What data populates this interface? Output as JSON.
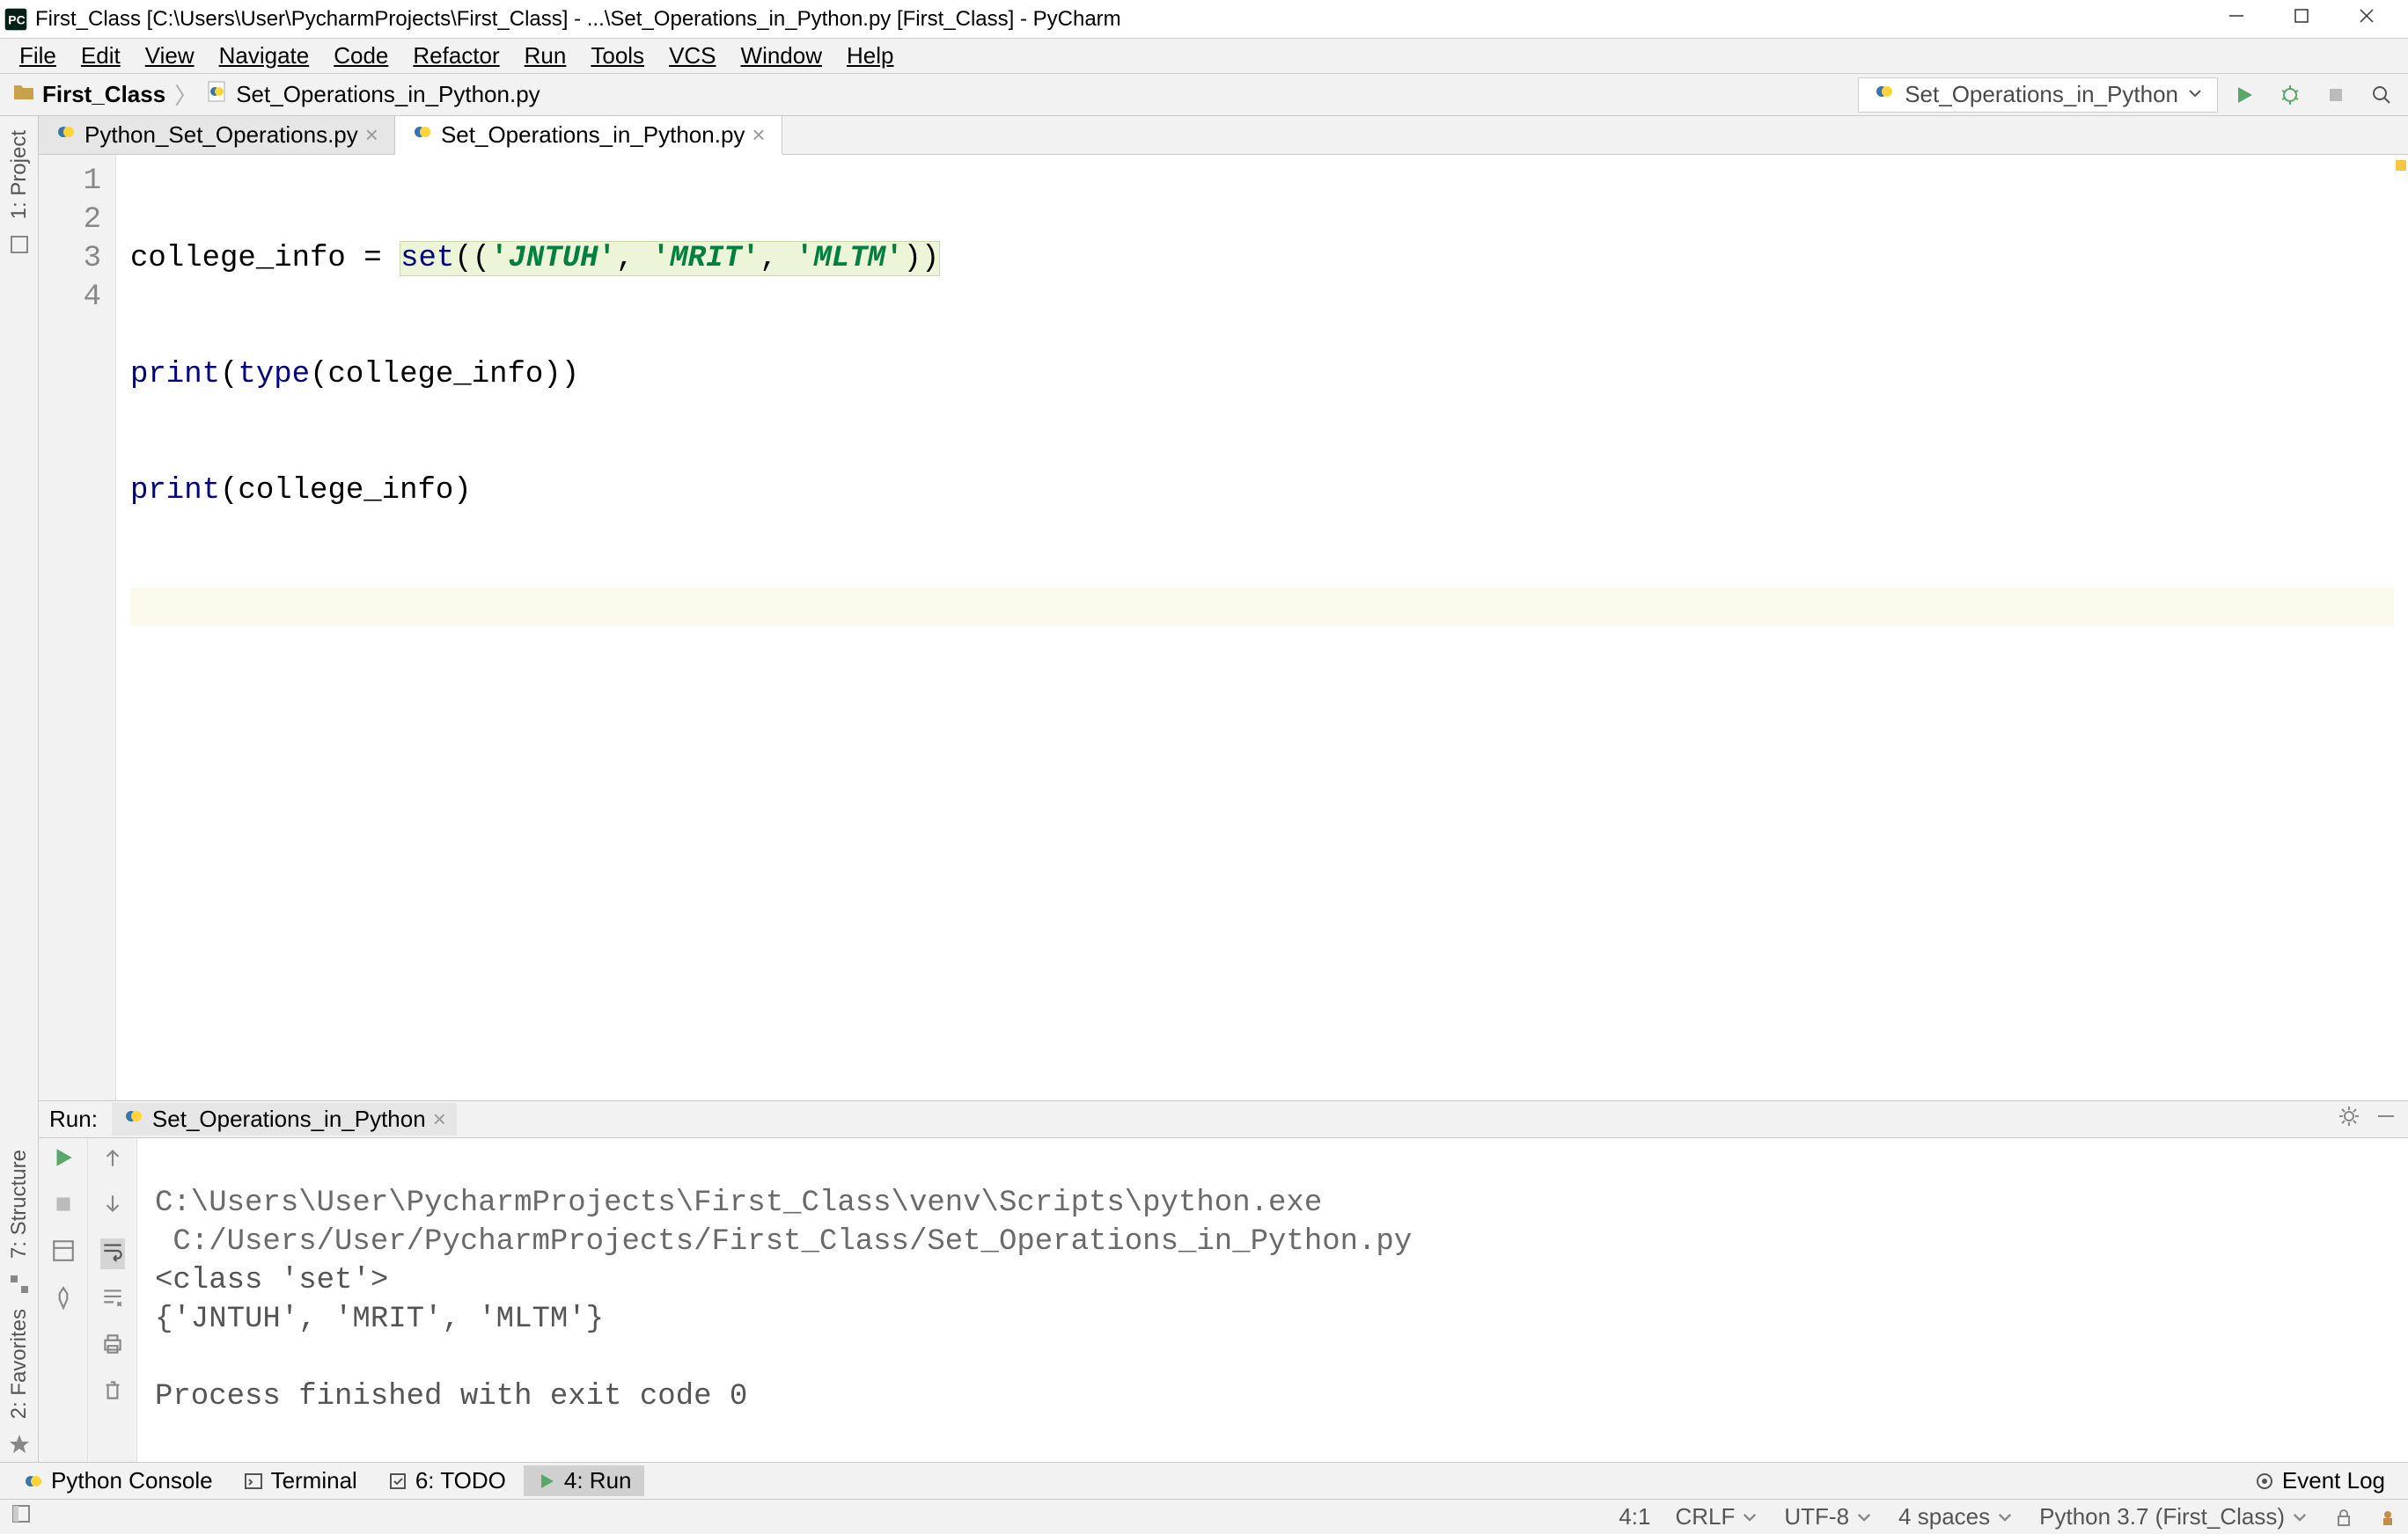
{
  "window": {
    "title": "First_Class [C:\\Users\\User\\PycharmProjects\\First_Class] - ...\\Set_Operations_in_Python.py [First_Class] - PyCharm"
  },
  "menu": {
    "file": "File",
    "edit": "Edit",
    "view": "View",
    "navigate": "Navigate",
    "code": "Code",
    "refactor": "Refactor",
    "run": "Run",
    "tools": "Tools",
    "vcs": "VCS",
    "window": "Window",
    "help": "Help"
  },
  "breadcrumb": {
    "project": "First_Class",
    "file": "Set_Operations_in_Python.py"
  },
  "run_config": {
    "selected": "Set_Operations_in_Python"
  },
  "side_tabs": {
    "project": "1: Project",
    "structure": "7: Structure",
    "favorites": "2: Favorites"
  },
  "editor": {
    "tabs": [
      {
        "label": "Python_Set_Operations.py"
      },
      {
        "label": "Set_Operations_in_Python.py"
      }
    ],
    "active_tab": 1,
    "gutter": [
      "1",
      "2",
      "3",
      "4"
    ],
    "code": {
      "line1_pre": "college_info = ",
      "line1_set": "set",
      "line1_paren_open": "((",
      "line1_q1": "'",
      "line1_s1": "JNTUH",
      "line1_q2": "'",
      "line1_c1": ", ",
      "line1_q3": "'",
      "line1_s2": "MRIT",
      "line1_q4": "'",
      "line1_c2": ", ",
      "line1_q5": "'",
      "line1_s3": "MLTM",
      "line1_q6": "'",
      "line1_paren_close": "))",
      "line2_print": "print",
      "line2_open": "(",
      "line2_type": "type",
      "line2_rest": "(college_info))",
      "line3_print": "print",
      "line3_rest": "(college_info)"
    }
  },
  "run_panel": {
    "label": "Run:",
    "tab": "Set_Operations_in_Python",
    "output_cmd1": "C:\\Users\\User\\PycharmProjects\\First_Class\\venv\\Scripts\\python.exe ",
    "output_cmd2": " C:/Users/User/PycharmProjects/First_Class/Set_Operations_in_Python.py",
    "output_l1": "<class 'set'>",
    "output_l2": "{'JNTUH', 'MRIT', 'MLTM'}",
    "output_blank": "",
    "output_proc": "Process finished with exit code 0"
  },
  "bottom_tabs": {
    "python_console": "Python Console",
    "terminal": "Terminal",
    "todo": "6: TODO",
    "run": "4: Run",
    "event_log": "Event Log"
  },
  "status": {
    "pos": "4:1",
    "line_sep": "CRLF",
    "encoding": "UTF-8",
    "indent": "4 spaces",
    "interpreter": "Python 3.7 (First_Class)"
  }
}
